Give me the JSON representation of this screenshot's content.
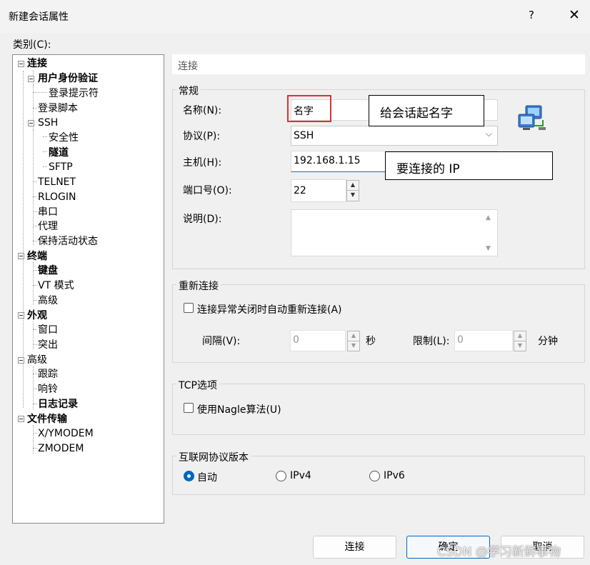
{
  "window": {
    "title": "新建会话属性",
    "help": "?",
    "close": "✕"
  },
  "category_label": "类别(C):",
  "tree": [
    "连接",
    "用户身份验证",
    "登录提示符",
    "登录脚本",
    "SSH",
    "安全性",
    "隧道",
    "SFTP",
    "TELNET",
    "RLOGIN",
    "串口",
    "代理",
    "保持活动状态",
    "终端",
    "键盘",
    "VT 模式",
    "高级",
    "外观",
    "窗口",
    "突出",
    "高级",
    "跟踪",
    "响铃",
    "日志记录",
    "文件传输",
    "X/YMODEM",
    "ZMODEM"
  ],
  "section_title": "连接",
  "general": {
    "title": "常规",
    "name_label": "名称(N):",
    "name_value": "名字",
    "protocol_label": "协议(P):",
    "protocol_value": "SSH",
    "host_label": "主机(H):",
    "host_value": "192.168.1.15",
    "port_label": "端口号(O):",
    "port_value": "22",
    "desc_label": "说明(D):",
    "desc_value": ""
  },
  "reconnect": {
    "title": "重新连接",
    "checkbox_label": "连接异常关闭时自动重新连接(A)",
    "interval_label": "间隔(V):",
    "interval_value": "0",
    "interval_unit": "秒",
    "limit_label": "限制(L):",
    "limit_value": "0",
    "limit_unit": "分钟"
  },
  "tcp": {
    "title": "TCP选项",
    "nagle_label": "使用Nagle算法(U)"
  },
  "ip": {
    "title": "互联网协议版本",
    "options": [
      "自动",
      "IPv4",
      "IPv6"
    ],
    "selected": "自动"
  },
  "annotations": {
    "name_note": "给会话起名字",
    "host_note": "要连接的 IP"
  },
  "buttons": {
    "connect": "连接",
    "ok": "确定",
    "cancel": "取消"
  },
  "watermark": "CSDN @学习新鲜事物",
  "colors": {
    "accent": "#0067c0",
    "annotation_red": "#e03030"
  },
  "icons": {
    "session": "network-computers-icon"
  }
}
